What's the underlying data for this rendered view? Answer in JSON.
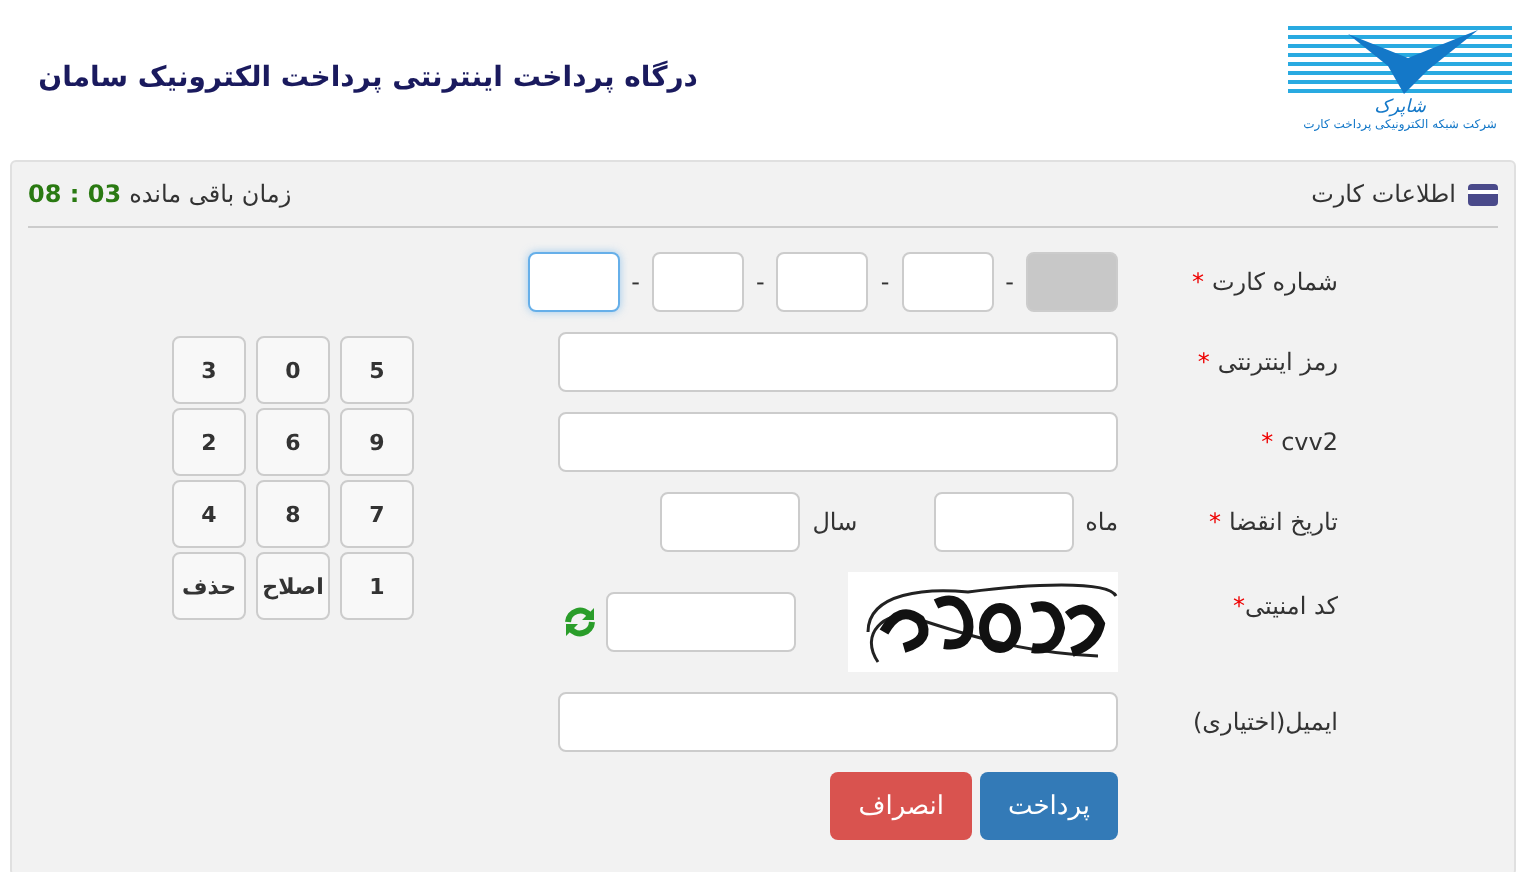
{
  "header": {
    "title": "درگاه پرداخت اینترنتی پرداخت الکترونیک سامان",
    "logo_name": "شاپرک",
    "logo_tagline": "شرکت شبکه الکترونیکی پرداخت کارت"
  },
  "panel": {
    "title": "اطلاعات کارت",
    "timer_label": "زمان باقی مانده",
    "timer_value": "08 : 03"
  },
  "form": {
    "card_number": {
      "label": "شماره کارت",
      "required_mark": "*",
      "separator": "-",
      "segments": [
        {
          "disabled": true,
          "focused": false
        },
        {
          "disabled": false,
          "focused": false
        },
        {
          "disabled": false,
          "focused": false
        },
        {
          "disabled": false,
          "focused": false
        },
        {
          "disabled": false,
          "focused": true
        }
      ]
    },
    "password": {
      "label": "رمز اینترنتی",
      "required_mark": "*"
    },
    "cvv2": {
      "label": "cvv2",
      "required_mark": "*"
    },
    "expiry": {
      "label": "تاریخ انقضا",
      "required_mark": "*",
      "month_label": "ماه",
      "year_label": "سال"
    },
    "captcha": {
      "label": "کد امنیتی",
      "required_mark": "*"
    },
    "email": {
      "label": "ایمیل(اختیاری)"
    }
  },
  "buttons": [
    {
      "label": "پرداخت",
      "kind": "primary"
    },
    {
      "label": "انصراف",
      "kind": "danger"
    }
  ],
  "keypad": [
    {
      "label": "5"
    },
    {
      "label": "0"
    },
    {
      "label": "3"
    },
    {
      "label": "9"
    },
    {
      "label": "6"
    },
    {
      "label": "2"
    },
    {
      "label": "7"
    },
    {
      "label": "8"
    },
    {
      "label": "4"
    },
    {
      "label": "1"
    },
    {
      "label": "اصلاح"
    },
    {
      "label": "حذف"
    }
  ]
}
